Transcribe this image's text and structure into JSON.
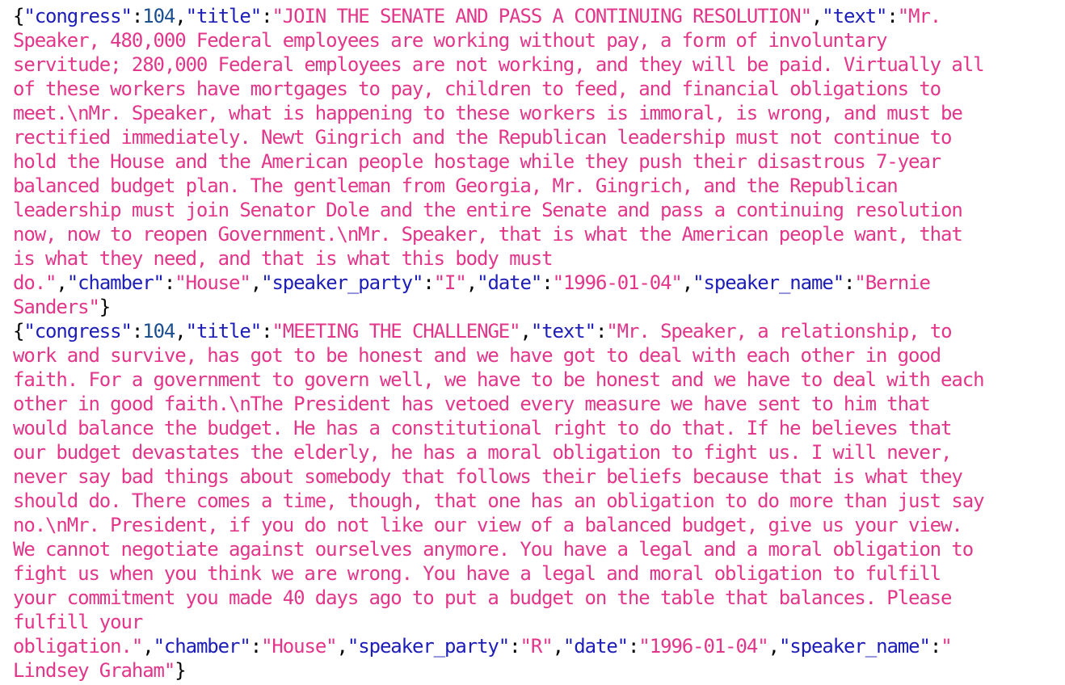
{
  "colors": {
    "punctuation": "#000000",
    "key": "#1d1db8",
    "string": "#e2368a",
    "number": "#1c4f8f",
    "background": "#ffffff"
  },
  "lines": [
    [
      {
        "t": "p",
        "v": "{"
      },
      {
        "t": "k",
        "v": "\"congress\""
      },
      {
        "t": "p",
        "v": ":"
      },
      {
        "t": "n",
        "v": "104"
      },
      {
        "t": "p",
        "v": ","
      },
      {
        "t": "k",
        "v": "\"title\""
      },
      {
        "t": "p",
        "v": ":"
      },
      {
        "t": "s",
        "v": "\"JOIN THE SENATE AND PASS A CONTINUING RESOLUTION\""
      },
      {
        "t": "p",
        "v": ","
      },
      {
        "t": "k",
        "v": "\"text\""
      },
      {
        "t": "p",
        "v": ":"
      },
      {
        "t": "s",
        "v": "\"Mr."
      }
    ],
    [
      {
        "t": "s",
        "v": "Speaker, 480,000 Federal employees are working without pay, a form of involuntary"
      }
    ],
    [
      {
        "t": "s",
        "v": "servitude; 280,000 Federal employees are not working, and they will be paid. Virtually all"
      }
    ],
    [
      {
        "t": "s",
        "v": "of these workers have mortgages to pay, children to feed, and financial obligations to"
      }
    ],
    [
      {
        "t": "s",
        "v": "meet.\\nMr. Speaker, what is happening to these workers is immoral, is wrong, and must be"
      }
    ],
    [
      {
        "t": "s",
        "v": "rectified immediately. Newt Gingrich and the Republican leadership must not continue to"
      }
    ],
    [
      {
        "t": "s",
        "v": "hold the House and the American people hostage while they push their disastrous 7-year"
      }
    ],
    [
      {
        "t": "s",
        "v": "balanced budget plan. The gentleman from Georgia, Mr. Gingrich, and the Republican"
      }
    ],
    [
      {
        "t": "s",
        "v": "leadership must join Senator Dole and the entire Senate and pass a continuing resolution"
      }
    ],
    [
      {
        "t": "s",
        "v": "now, now to reopen Government.\\nMr. Speaker, that is what the American people want, that"
      }
    ],
    [
      {
        "t": "s",
        "v": "is what they need, and that is what this body must"
      }
    ],
    [
      {
        "t": "s",
        "v": "do.\""
      },
      {
        "t": "p",
        "v": ","
      },
      {
        "t": "k",
        "v": "\"chamber\""
      },
      {
        "t": "p",
        "v": ":"
      },
      {
        "t": "s",
        "v": "\"House\""
      },
      {
        "t": "p",
        "v": ","
      },
      {
        "t": "k",
        "v": "\"speaker_party\""
      },
      {
        "t": "p",
        "v": ":"
      },
      {
        "t": "s",
        "v": "\"I\""
      },
      {
        "t": "p",
        "v": ","
      },
      {
        "t": "k",
        "v": "\"date\""
      },
      {
        "t": "p",
        "v": ":"
      },
      {
        "t": "s",
        "v": "\"1996-01-04\""
      },
      {
        "t": "p",
        "v": ","
      },
      {
        "t": "k",
        "v": "\"speaker_name\""
      },
      {
        "t": "p",
        "v": ":"
      },
      {
        "t": "s",
        "v": "\"Bernie"
      }
    ],
    [
      {
        "t": "s",
        "v": "Sanders\""
      },
      {
        "t": "p",
        "v": "}"
      }
    ],
    [
      {
        "t": "p",
        "v": "{"
      },
      {
        "t": "k",
        "v": "\"congress\""
      },
      {
        "t": "p",
        "v": ":"
      },
      {
        "t": "n",
        "v": "104"
      },
      {
        "t": "p",
        "v": ","
      },
      {
        "t": "k",
        "v": "\"title\""
      },
      {
        "t": "p",
        "v": ":"
      },
      {
        "t": "s",
        "v": "\"MEETING THE CHALLENGE\""
      },
      {
        "t": "p",
        "v": ","
      },
      {
        "t": "k",
        "v": "\"text\""
      },
      {
        "t": "p",
        "v": ":"
      },
      {
        "t": "s",
        "v": "\"Mr. Speaker, a relationship, to"
      }
    ],
    [
      {
        "t": "s",
        "v": "work and survive, has got to be honest and we have got to deal with each other in good"
      }
    ],
    [
      {
        "t": "s",
        "v": "faith. For a government to govern well, we have to be honest and we have to deal with each"
      }
    ],
    [
      {
        "t": "s",
        "v": "other in good faith.\\nThe President has vetoed every measure we have sent to him that"
      }
    ],
    [
      {
        "t": "s",
        "v": "would balance the budget. He has a constitutional right to do that. If he believes that"
      }
    ],
    [
      {
        "t": "s",
        "v": "our budget devastates the elderly, he has a moral obligation to fight us. I will never,"
      }
    ],
    [
      {
        "t": "s",
        "v": "never say bad things about somebody that follows their beliefs because that is what they"
      }
    ],
    [
      {
        "t": "s",
        "v": "should do. There comes a time, though, that one has an obligation to do more than just say"
      }
    ],
    [
      {
        "t": "s",
        "v": "no.\\nMr. President, if you do not like our view of a balanced budget, give us your view."
      }
    ],
    [
      {
        "t": "s",
        "v": "We cannot negotiate against ourselves anymore. You have a legal and a moral obligation to"
      }
    ],
    [
      {
        "t": "s",
        "v": "fight us when you think we are wrong. You have a legal and moral obligation to fulfill"
      }
    ],
    [
      {
        "t": "s",
        "v": "your commitment you made 40 days ago to put a budget on the table that balances. Please"
      }
    ],
    [
      {
        "t": "s",
        "v": "fulfill your"
      }
    ],
    [
      {
        "t": "s",
        "v": "obligation.\""
      },
      {
        "t": "p",
        "v": ","
      },
      {
        "t": "k",
        "v": "\"chamber\""
      },
      {
        "t": "p",
        "v": ":"
      },
      {
        "t": "s",
        "v": "\"House\""
      },
      {
        "t": "p",
        "v": ","
      },
      {
        "t": "k",
        "v": "\"speaker_party\""
      },
      {
        "t": "p",
        "v": ":"
      },
      {
        "t": "s",
        "v": "\"R\""
      },
      {
        "t": "p",
        "v": ","
      },
      {
        "t": "k",
        "v": "\"date\""
      },
      {
        "t": "p",
        "v": ":"
      },
      {
        "t": "s",
        "v": "\"1996-01-04\""
      },
      {
        "t": "p",
        "v": ","
      },
      {
        "t": "k",
        "v": "\"speaker_name\""
      },
      {
        "t": "p",
        "v": ":"
      },
      {
        "t": "s",
        "v": "\""
      }
    ],
    [
      {
        "t": "s",
        "v": "Lindsey Graham\""
      },
      {
        "t": "p",
        "v": "}"
      }
    ]
  ]
}
